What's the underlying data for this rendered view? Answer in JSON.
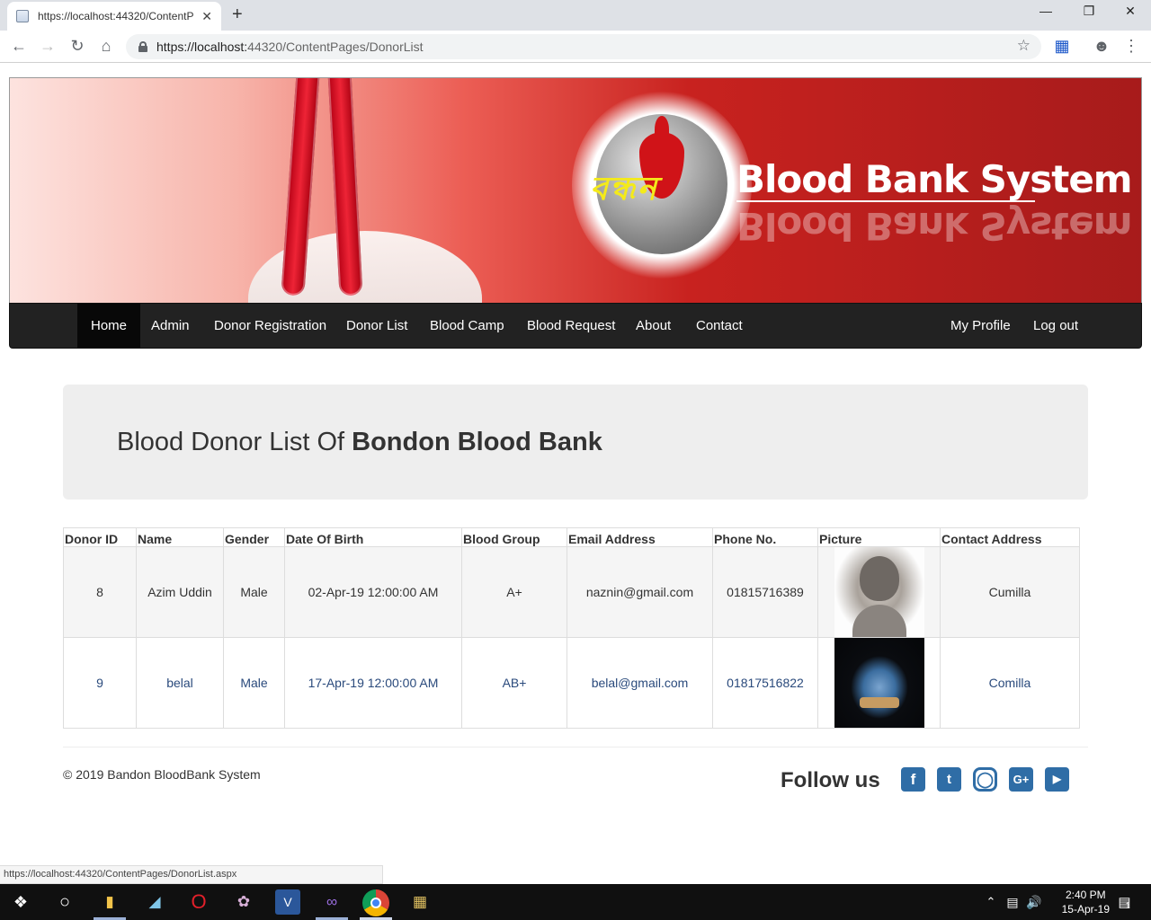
{
  "browser": {
    "tab_title": "https://localhost:44320/ContentP",
    "tab_close": "✕",
    "new_tab": "+",
    "url_host": "https://localhost:",
    "url_rest": "44320/ContentPages/DonorList",
    "status_url": "https://localhost:44320/ContentPages/DonorList.aspx"
  },
  "banner": {
    "brand_bengali": "বন্ধন",
    "brand_text": "Blood Bank System"
  },
  "nav": {
    "home": "Home",
    "admin": "Admin",
    "donor_registration": "Donor Registration",
    "donor_list": "Donor List",
    "blood_camp": "Blood Camp",
    "blood_request": "Blood Request",
    "about": "About",
    "contact": "Contact",
    "my_profile": "My Profile",
    "log_out": "Log out"
  },
  "jumbotron": {
    "title_prefix": "Blood Donor List Of ",
    "title_bold": "Bondon Blood Bank"
  },
  "table": {
    "headers": [
      "Donor ID",
      "Name",
      "Gender",
      "Date Of Birth",
      "Blood Group",
      "Email Address",
      "Phone No.",
      "Picture",
      "Contact Address"
    ],
    "rows": [
      {
        "id": "8",
        "name": "Azim Uddin",
        "gender": "Male",
        "dob": "02-Apr-19 12:00:00 AM",
        "blood_group": "A+",
        "email": "naznin@gmail.com",
        "phone": "01815716389",
        "address": "Cumilla"
      },
      {
        "id": "9",
        "name": "belal",
        "gender": "Male",
        "dob": "17-Apr-19 12:00:00 AM",
        "blood_group": "AB+",
        "email": "belal@gmail.com",
        "phone": "01817516822",
        "address": "Comilla"
      }
    ]
  },
  "footer": {
    "copyright": "© 2019 Bandon BloodBank System",
    "follow_us": "Follow us",
    "social": [
      "facebook-icon",
      "twitter-icon",
      "instagram-icon",
      "google-plus-icon",
      "youtube-icon"
    ]
  },
  "taskbar": {
    "time": "2:40 PM",
    "date": "15-Apr-19",
    "notifications": "1"
  },
  "colors": {
    "banner_dark_red": "#a71b1b",
    "navbar": "#222222",
    "social_blue": "#2f6da6"
  }
}
